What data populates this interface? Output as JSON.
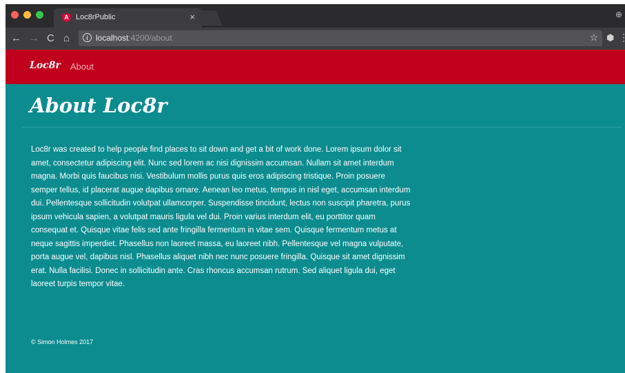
{
  "browser": {
    "tab": {
      "favicon": "A",
      "title": "Loc8rPublic",
      "close_glyph": "×"
    },
    "address_bar": {
      "url_host": "localhost",
      "url_rest": ":4200/about"
    },
    "icons": {
      "back": "←",
      "forward": "→",
      "reload": "C",
      "home": "⌂",
      "info": "i",
      "bookmark_star": "☆",
      "extension": "⬢",
      "menu": "⋮",
      "incognito": "⊕"
    }
  },
  "navbar": {
    "brand": "Loc8r",
    "links": [
      {
        "label": "About"
      }
    ],
    "background": "#c1001e",
    "link_color": "#f3aab4"
  },
  "page": {
    "title": "About Loc8r",
    "body": "Loc8r was created to help people find places to sit down and get a bit of work done. Lorem ipsum dolor sit amet, consectetur adipiscing elit. Nunc sed lorem ac nisi dignissim accumsan. Nullam sit amet interdum magna. Morbi quis faucibus nisi. Vestibulum mollis purus quis eros adipiscing tristique. Proin posuere semper tellus, id placerat augue dapibus ornare. Aenean leo metus, tempus in nisl eget, accumsan interdum dui. Pellentesque sollicitudin volutpat ullamcorper. Suspendisse tincidunt, lectus non suscipit pharetra, purus ipsum vehicula sapien, a volutpat mauris ligula vel dui. Proin varius interdum elit, eu porttitor quam consequat et. Quisque vitae felis sed ante fringilla fermentum in vitae sem. Quisque fermentum metus at neque sagittis imperdiet. Phasellus non laoreet massa, eu laoreet nibh. Pellentesque vel magna vulputate, porta augue vel, dapibus nisl. Phasellus aliquet nibh nec nunc posuere fringilla. Quisque sit amet dignissim erat. Nulla facilisi. Donec in sollicitudin ante. Cras rhoncus accumsan rutrum. Sed aliquet ligula dui, eget laoreet turpis tempor vitae.",
    "footer": "© Simon Holmes 2017",
    "background": "#0c8c8f"
  }
}
